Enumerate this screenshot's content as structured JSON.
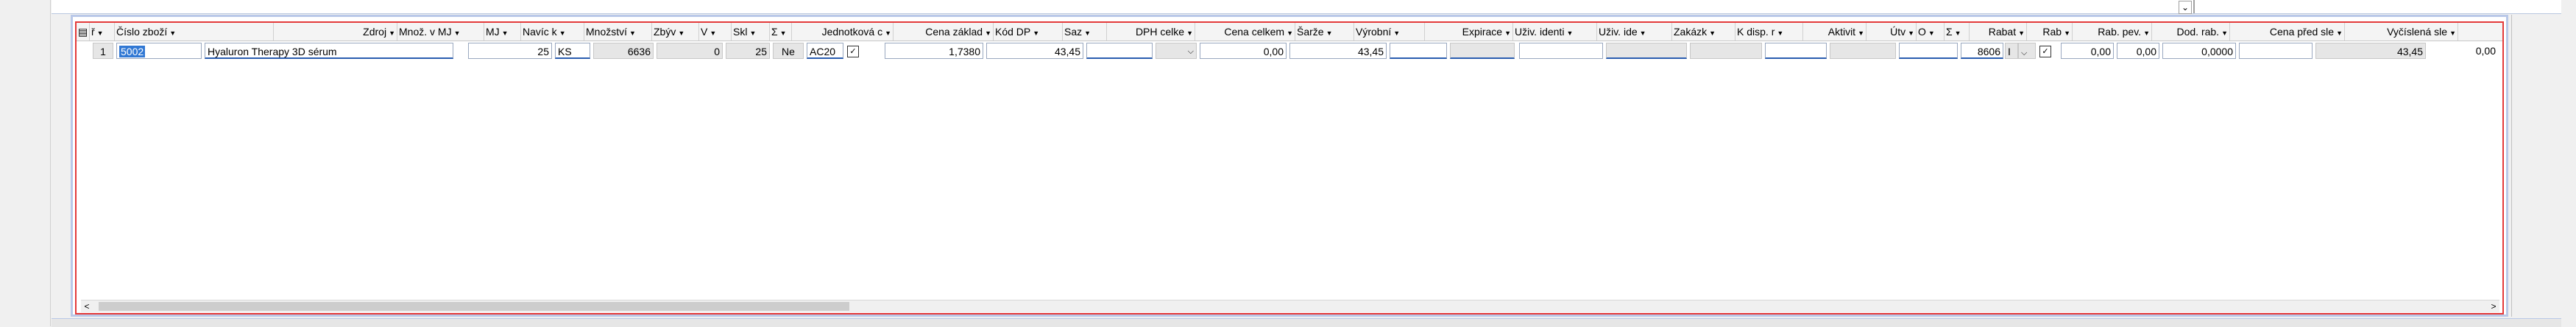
{
  "top": {
    "combo_arrow": "⌄"
  },
  "header": {
    "columns": [
      {
        "label": "ř"
      },
      {
        "label": "Číslo zboží"
      },
      {
        "label": "Zdroj"
      },
      {
        "label": "Množ. v MJ"
      },
      {
        "label": "MJ"
      },
      {
        "label": "Navíc k"
      },
      {
        "label": "Množství"
      },
      {
        "label": "Zbýv"
      },
      {
        "label": "V"
      },
      {
        "label": "Skl"
      },
      {
        "label": "Σ"
      },
      {
        "label": "Jednotková c"
      },
      {
        "label": "Cena základ"
      },
      {
        "label": "Kód DP"
      },
      {
        "label": "Saz"
      },
      {
        "label": "DPH celke"
      },
      {
        "label": "Cena celkem"
      },
      {
        "label": "Šarže"
      },
      {
        "label": "Výrobní"
      },
      {
        "label": "Expirace"
      },
      {
        "label": "Uživ. identi"
      },
      {
        "label": "Uživ. ide"
      },
      {
        "label": "Zakázk"
      },
      {
        "label": "K disp. r"
      },
      {
        "label": "Aktivit"
      },
      {
        "label": "Útv"
      },
      {
        "label": "O"
      },
      {
        "label": "Σ"
      },
      {
        "label": "Rabat"
      },
      {
        "label": "Rab"
      },
      {
        "label": "Rab. pev."
      },
      {
        "label": "Dod. rab."
      },
      {
        "label": "Cena před sle"
      },
      {
        "label": "Vyčíslená sle"
      }
    ]
  },
  "row": {
    "line_no": "1",
    "item_code": "5002",
    "description": "Hyaluron Therapy 3D sérum",
    "qty_mj": "25",
    "mj": "KS",
    "navic": "6636",
    "mnozstvi": "0",
    "zbyva": "25",
    "v": "Ne",
    "skl": "AC20",
    "skl_check": "✓",
    "unit_price": "1,7380",
    "base_price": "43,45",
    "vat_total": "0,00",
    "total_price": "43,45",
    "utv": "8606",
    "utv_extra": "I",
    "o_check": "✓",
    "rabat": "0,00",
    "rab": "0,00",
    "rab_pev": "0,0000",
    "price_before": "43,45",
    "vycislena": "0,00"
  },
  "scroll": {
    "left_arrow": "<",
    "right_arrow": ">"
  }
}
